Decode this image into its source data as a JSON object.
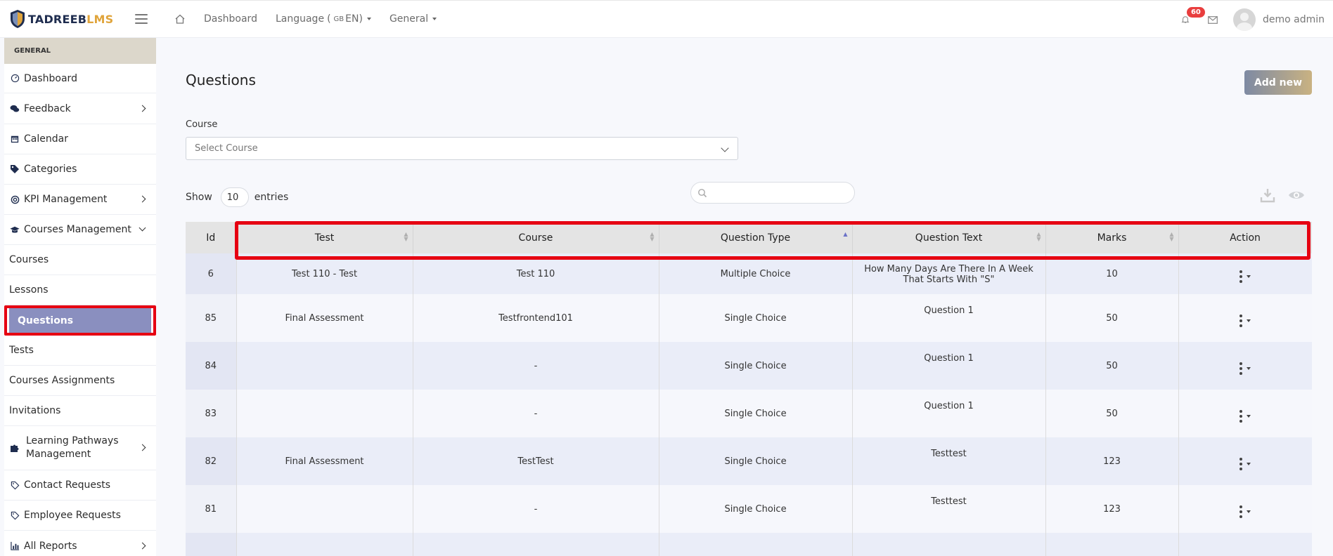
{
  "brand": {
    "part1": "TADREEB",
    "part2": "LMS"
  },
  "topnav": {
    "dashboard": "Dashboard",
    "language": "Language",
    "language_flag": "GB",
    "language_code": "EN",
    "general": "General",
    "notification_count": "60",
    "user_name": "demo admin"
  },
  "sidebar": {
    "header": "GENERAL",
    "items": [
      {
        "label": "Dashboard",
        "icon": "gauge-icon"
      },
      {
        "label": "Feedback",
        "icon": "comments-icon"
      },
      {
        "label": "Calendar",
        "icon": "calendar-icon"
      },
      {
        "label": "Categories",
        "icon": "tags-icon"
      },
      {
        "label": "KPI Management",
        "icon": "target-icon"
      },
      {
        "label": "Courses Management",
        "icon": "graduation-cap-icon"
      },
      {
        "label": "Courses"
      },
      {
        "label": "Lessons"
      },
      {
        "label": "Questions"
      },
      {
        "label": "Tests"
      },
      {
        "label": "Courses Assignments"
      },
      {
        "label": "Invitations"
      },
      {
        "label1": "Learning Pathways",
        "label2": "Management",
        "icon": "puzzle-icon"
      },
      {
        "label": "Contact Requests",
        "icon": "tag-icon"
      },
      {
        "label": "Employee Requests",
        "icon": "tag-icon"
      },
      {
        "label": "All Reports",
        "icon": "bar-chart-icon"
      }
    ]
  },
  "page": {
    "title": "Questions",
    "add_button": "Add new",
    "course_label": "Course",
    "course_placeholder": "Select Course",
    "show_label": "Show",
    "entries_value": "10",
    "entries_label": "entries"
  },
  "table": {
    "columns": [
      "Id",
      "Test",
      "Course",
      "Question Type",
      "Question Text",
      "Marks",
      "Action"
    ],
    "rows": [
      {
        "id": "6",
        "test": "Test 110 - Test",
        "course": "Test 110",
        "type": "Multiple Choice",
        "text": "How Many Days Are There In A Week That Starts With \"S\"",
        "marks": "10"
      },
      {
        "id": "85",
        "test": "Final Assessment",
        "course": "Testfrontend101",
        "type": "Single Choice",
        "text": "Question 1",
        "marks": "50"
      },
      {
        "id": "84",
        "test": "",
        "course": "-",
        "type": "Single Choice",
        "text": "Question 1",
        "marks": "50"
      },
      {
        "id": "83",
        "test": "",
        "course": "-",
        "type": "Single Choice",
        "text": "Question 1",
        "marks": "50"
      },
      {
        "id": "82",
        "test": "Final Assessment",
        "course": "TestTest",
        "type": "Single Choice",
        "text": "Testtest",
        "marks": "123"
      },
      {
        "id": "81",
        "test": "",
        "course": "-",
        "type": "Single Choice",
        "text": "Testtest",
        "marks": "123"
      },
      {
        "id": "",
        "test": "",
        "course": "",
        "type": "",
        "text": "",
        "marks": ""
      }
    ]
  },
  "colors": {
    "accent": "#8a8fbf",
    "highlight": "#e60012",
    "badge": "#e93e3e",
    "brand_gold": "#e0a43b",
    "brand_navy": "#1f2d4f"
  }
}
